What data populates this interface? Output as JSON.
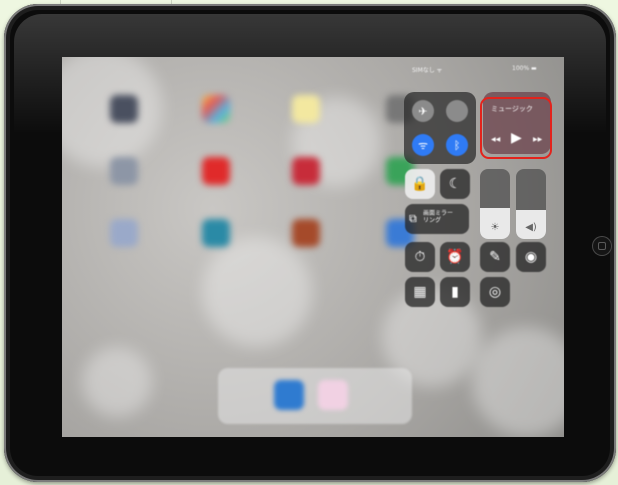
{
  "status_bar": {
    "carrier": "SIMなし ᯤ",
    "battery": "100% ▬"
  },
  "control_center": {
    "connectivity": {
      "airplane": "✈",
      "cellular": "",
      "wifi": "ᯤ",
      "bluetooth": "ᛒ"
    },
    "music": {
      "title": "ミュージック",
      "prev": "◀◀",
      "play": "▶",
      "next": "▶▶"
    },
    "rotation_lock": "🔒",
    "do_not_disturb": "☾",
    "screen_mirroring": "画面ミラー\nリング",
    "brightness_icon": "☀",
    "volume_icon": "◀)",
    "brightness_level": 0.45,
    "volume_level": 0.42,
    "timer": "⏱",
    "alarm": "⏰",
    "notes": "✎",
    "camera": "◉",
    "calculator": "▦",
    "flashlight": "▮",
    "screen_record": "◎"
  },
  "colors": {
    "highlight": "#e3231c",
    "accent_blue": "#2f7bf5",
    "music_bg": "#6e4650"
  }
}
